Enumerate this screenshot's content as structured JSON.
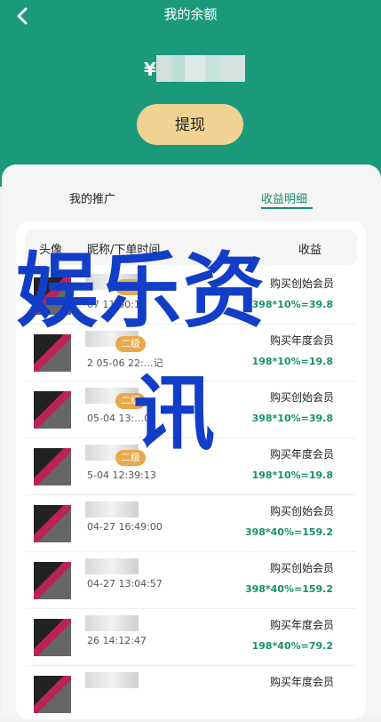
{
  "header": {
    "title": "我的余额",
    "amount_prefix": "¥"
  },
  "actions": {
    "withdraw_label": "提现"
  },
  "tabs": [
    {
      "label": "我的推广"
    },
    {
      "label": "收益明细"
    }
  ],
  "table": {
    "headers": [
      "头像",
      "昵称/下单时间",
      "收益"
    ],
    "rows": [
      {
        "badge": "二级",
        "time": "07 11:50:12",
        "income_title": "购买创始会员",
        "income_value": "398*10%=39.8"
      },
      {
        "badge": "二级",
        "time": "2 05-06 22:…记",
        "income_title": "购买年度会员",
        "income_value": "198*10%=19.8"
      },
      {
        "badge": "二级",
        "time": "05-04 13:…02",
        "income_title": "购买创始会员",
        "income_value": "398*10%=39.8"
      },
      {
        "badge": "二级",
        "time": "5-04 12:39:13",
        "income_title": "购买年度会员",
        "income_value": "198*10%=19.8"
      },
      {
        "badge": "",
        "time": "04-27 16:49:00",
        "income_title": "购买创始会员",
        "income_value": "398*40%=159.2"
      },
      {
        "badge": "",
        "time": "04-27 13:04:57",
        "income_title": "购买创始会员",
        "income_value": "398*40%=159.2"
      },
      {
        "badge": "",
        "time": "26 14:12:47",
        "income_title": "购买年度会员",
        "income_value": "198*40%=79.2"
      },
      {
        "badge": "",
        "time": "",
        "income_title": "购买年度会员",
        "income_value": ""
      }
    ]
  },
  "overlay": {
    "line1": "娱乐资",
    "line2": "讯"
  }
}
